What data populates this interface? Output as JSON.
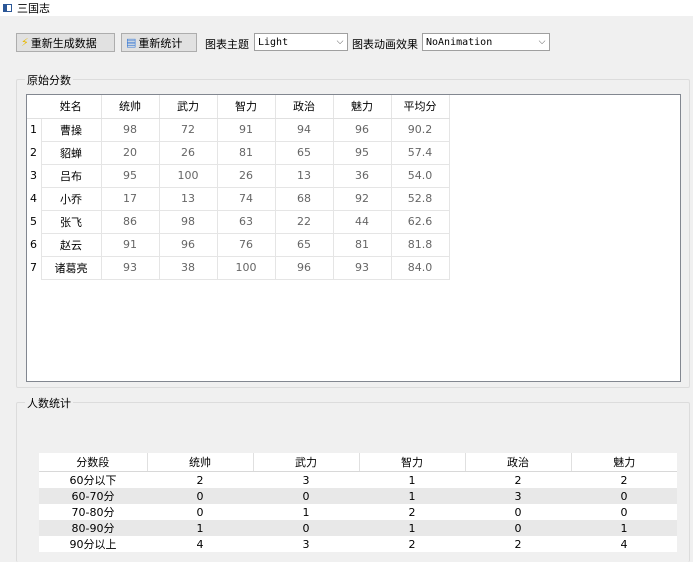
{
  "window": {
    "title": "三国志"
  },
  "toolbar": {
    "regenerate_label": "重新生成数据",
    "recount_label": "重新统计",
    "theme_label": "图表主题",
    "theme_value": "Light",
    "animation_label": "图表动画效果",
    "animation_value": "NoAnimation"
  },
  "score_group": {
    "title": "原始分数",
    "headers": [
      "姓名",
      "统帅",
      "武力",
      "智力",
      "政治",
      "魅力",
      "平均分"
    ],
    "rows": [
      {
        "num": "1",
        "cells": [
          "曹操",
          "98",
          "72",
          "91",
          "94",
          "96",
          "90.2"
        ]
      },
      {
        "num": "2",
        "cells": [
          "貂蝉",
          "20",
          "26",
          "81",
          "65",
          "95",
          "57.4"
        ]
      },
      {
        "num": "3",
        "cells": [
          "吕布",
          "95",
          "100",
          "26",
          "13",
          "36",
          "54.0"
        ]
      },
      {
        "num": "4",
        "cells": [
          "小乔",
          "17",
          "13",
          "74",
          "68",
          "92",
          "52.8"
        ]
      },
      {
        "num": "5",
        "cells": [
          "张飞",
          "86",
          "98",
          "63",
          "22",
          "44",
          "62.6"
        ]
      },
      {
        "num": "6",
        "cells": [
          "赵云",
          "91",
          "96",
          "76",
          "65",
          "81",
          "81.8"
        ]
      },
      {
        "num": "7",
        "cells": [
          "诸葛亮",
          "93",
          "38",
          "100",
          "96",
          "93",
          "84.0"
        ]
      }
    ]
  },
  "stats_group": {
    "title": "人数统计",
    "headers": [
      "分数段",
      "统帅",
      "武力",
      "智力",
      "政治",
      "魅力"
    ],
    "rows": [
      [
        "60分以下",
        "2",
        "3",
        "1",
        "2",
        "2"
      ],
      [
        "60-70分",
        "0",
        "0",
        "1",
        "3",
        "0"
      ],
      [
        "70-80分",
        "0",
        "1",
        "2",
        "0",
        "0"
      ],
      [
        "80-90分",
        "1",
        "0",
        "1",
        "0",
        "1"
      ],
      [
        "90分以上",
        "4",
        "3",
        "2",
        "2",
        "4"
      ]
    ]
  },
  "colors": {
    "window_bg": "#f0f0f0",
    "button_bg": "#e1e1e1",
    "stripe": "#e8e8e8",
    "number_text": "#666666"
  }
}
